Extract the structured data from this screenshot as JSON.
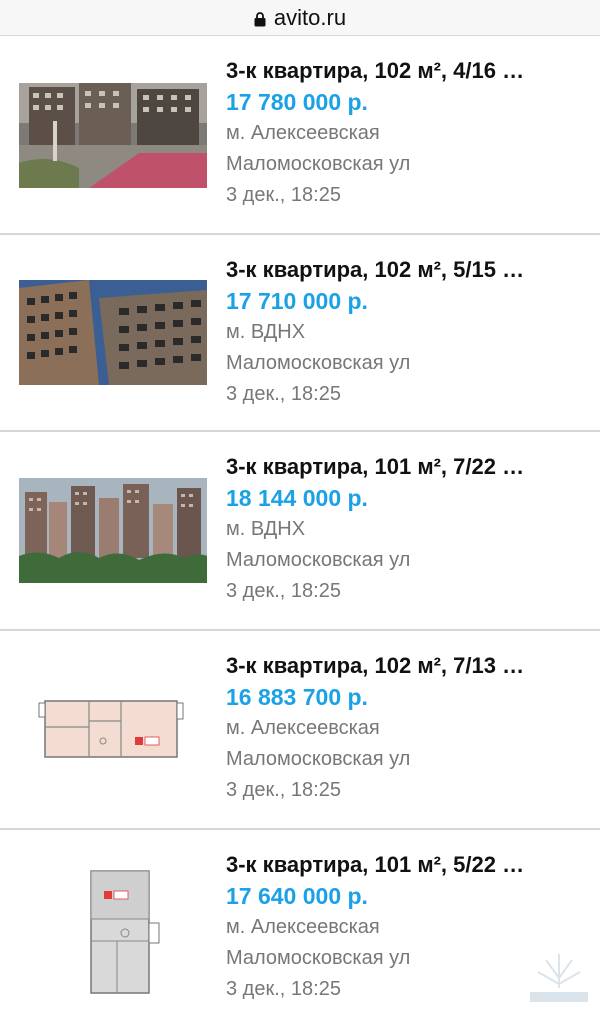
{
  "url": {
    "text": "avito.ru",
    "icon": "lock-icon"
  },
  "listings": [
    {
      "title": "3-к квартира, 102 м², 4/16 …",
      "price": "17 780 000 р.",
      "metro": "м. Алексеевская",
      "street": "Маломосковская ул",
      "date": "3 дек., 18:25",
      "image": "photo-courtyard"
    },
    {
      "title": "3-к квартира, 102 м², 5/15 …",
      "price": "17 710 000 р.",
      "metro": "м. ВДНХ",
      "street": "Маломосковская ул",
      "date": "3 дек., 18:25",
      "image": "photo-facade"
    },
    {
      "title": "3-к квартира, 101 м², 7/22 …",
      "price": "18 144 000 р.",
      "metro": "м. ВДНХ",
      "street": "Маломосковская ул",
      "date": "3 дек., 18:25",
      "image": "photo-towers"
    },
    {
      "title": "3-к квартира, 102 м², 7/13 …",
      "price": "16 883 700 р.",
      "metro": "м. Алексеевская",
      "street": "Маломосковская ул",
      "date": "3 дек., 18:25",
      "image": "floorplan-wide"
    },
    {
      "title": "3-к квартира, 101 м², 5/22 …",
      "price": "17 640 000 р.",
      "metro": "м. Алексеевская",
      "street": "Маломосковская ул",
      "date": "3 дек., 18:25",
      "image": "floorplan-tall"
    }
  ],
  "colors": {
    "price": "#1aa1e6",
    "meta": "#777777",
    "divider": "#d6d6d6"
  }
}
